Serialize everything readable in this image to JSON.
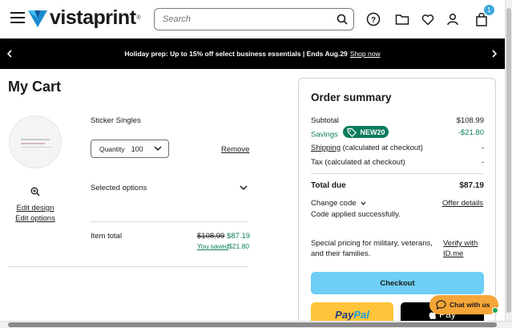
{
  "header": {
    "logo_text": "vistaprint",
    "logo_mark": "®",
    "search_placeholder": "Search",
    "cart_count": "1"
  },
  "promo": {
    "text": "Holiday prep: Up to 15% off select business essentials | Ends Aug.29",
    "link": "Shop now"
  },
  "cart": {
    "title": "My Cart",
    "product_name": "Sticker Singles",
    "quantity_label": "Quantity",
    "quantity_value": "100",
    "remove_label": "Remove",
    "edit_design": "Edit design",
    "edit_options": "Edit options",
    "selected_options": "Selected options",
    "item_total_label": "Item total",
    "old_price": "$108.99",
    "new_price": "$87.19",
    "you_saved_label": "You saved",
    "you_saved_value": "$21.80"
  },
  "summary": {
    "title": "Order summary",
    "subtotal_label": "Subtotal",
    "subtotal_value": "$108.99",
    "savings_label": "Savings",
    "coupon_code": "NEW20",
    "savings_value": "-$21.80",
    "shipping_label": "Shipping",
    "shipping_note": "(calculated at checkout)",
    "shipping_value": "-",
    "tax_label": "Tax (calculated at checkout)",
    "tax_value": "-",
    "total_label": "Total due",
    "total_value": "$87.19",
    "change_code": "Change code",
    "offer_details": "Offer details",
    "code_applied": "Code applied successfully.",
    "special_pricing": "Special pricing for military, veterans, and their families.",
    "verify": "Verify with ID.me",
    "checkout": "Checkout",
    "paypal_1": "Pay",
    "paypal_2": "Pal",
    "applepay": "Pay",
    "chat": "Chat with us"
  },
  "colors": {
    "accent_green": "#0d7c5e",
    "checkout_blue": "#6ecef5",
    "chat_orange": "#f6a638"
  }
}
